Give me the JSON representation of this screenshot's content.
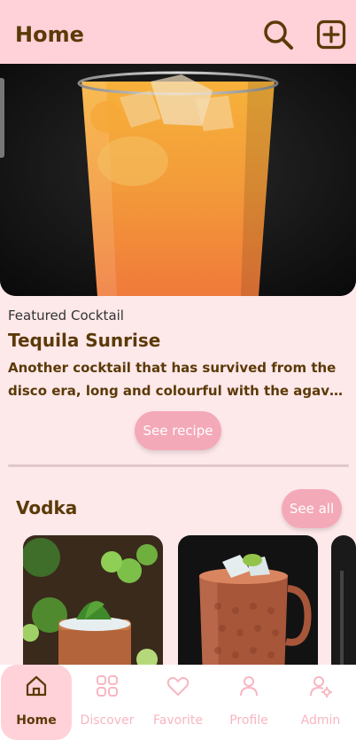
{
  "header": {
    "title": "Home",
    "search_icon": "search-icon",
    "add_icon": "add-square-icon"
  },
  "featured": {
    "label": "Featured Cocktail",
    "name": "Tequila Sunrise",
    "description": "Another cocktail that has survived from the disco era, long and colourful with the agave flavours of tequila.",
    "button_label": "See recipe"
  },
  "section": {
    "title": "Vodka",
    "see_all_label": "See all",
    "cards": [
      {
        "image": "mojito-copper-mug-photo"
      },
      {
        "image": "moscow-mule-copper-mug-photo"
      },
      {
        "image": "cocktail-photo-partial"
      }
    ]
  },
  "nav": {
    "items": [
      {
        "label": "Home",
        "icon": "home-icon",
        "active": true
      },
      {
        "label": "Discover",
        "icon": "grid-icon",
        "active": false
      },
      {
        "label": "Favorite",
        "icon": "heart-icon",
        "active": false
      },
      {
        "label": "Profile",
        "icon": "user-icon",
        "active": false
      },
      {
        "label": "Admin",
        "icon": "user-settings-icon",
        "active": false
      }
    ]
  },
  "colors": {
    "background": "#fde8ea",
    "header": "#ffd1d9",
    "accent": "#f4a9b8",
    "text_brown": "#5b3a07",
    "nav_inactive": "#f7b6c2"
  }
}
